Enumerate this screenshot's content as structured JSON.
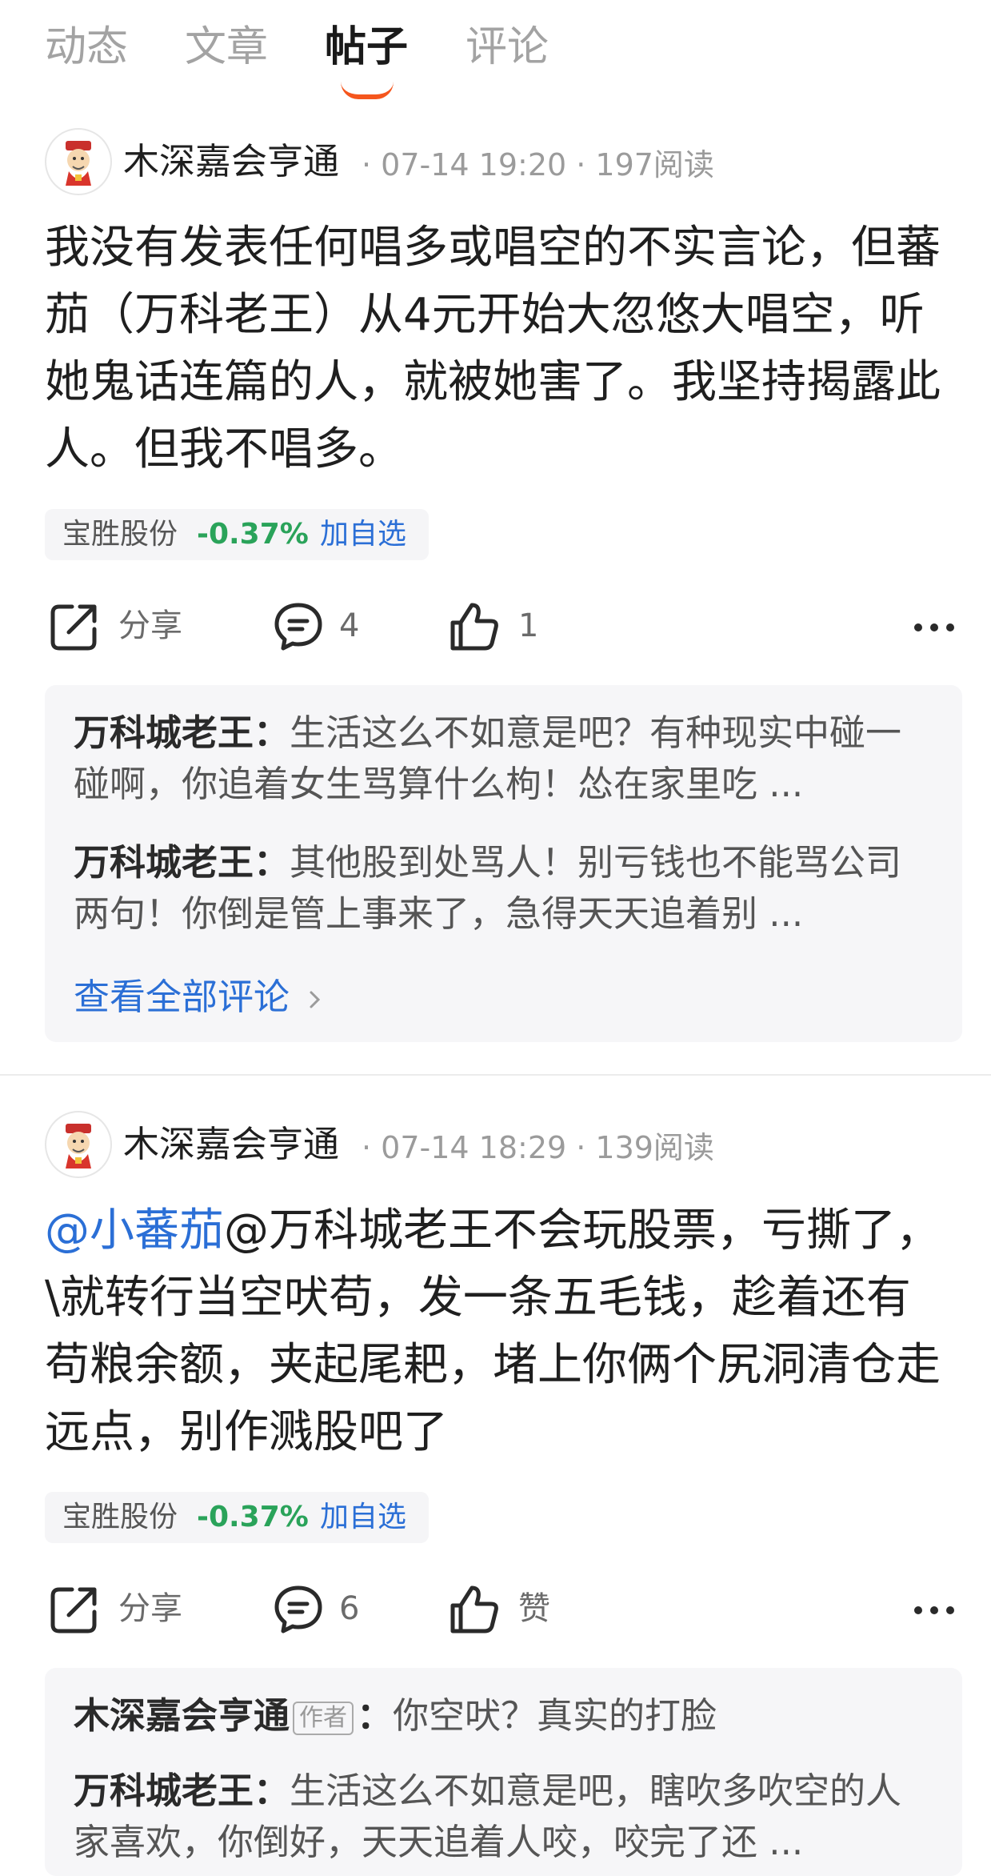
{
  "tabs": [
    {
      "label": "动态"
    },
    {
      "label": "文章"
    },
    {
      "label": "帖子"
    },
    {
      "label": "评论"
    }
  ],
  "active_tab": "帖子",
  "posts": [
    {
      "author": "木深嘉会亨通",
      "meta": "· 07-14 19:20 · 197阅读",
      "body_mention": "",
      "body": "我没有发表任何唱多或唱空的不实言论，但蕃茄（万科老王）从4元开始大忽悠大唱空，听她鬼话连篇的人，就被她害了。我坚持揭露此人。但我不唱多。",
      "stock": {
        "name": "宝胜股份",
        "change": "-0.37%",
        "add": "加自选"
      },
      "share": "分享",
      "comment_count": "4",
      "like_label": "1",
      "comments": [
        {
          "name": "万科城老王",
          "badge": "",
          "text": "生活这么不如意是吧？有种现实中碰一碰啊，你追着女生骂算什么枸！怂在家里吃 ..."
        },
        {
          "name": "万科城老王",
          "badge": "",
          "text": "其他股到处骂人！别亏钱也不能骂公司两句！你倒是管上事来了，急得天天追着别 ..."
        }
      ],
      "see_all": "查看全部评论"
    },
    {
      "author": "木深嘉会亨通",
      "meta": "· 07-14 18:29 · 139阅读",
      "body_mention": "@小蕃茄",
      "body": "@万科城老王不会玩股票，亏撕了，\\就转行当空吠苟，发一条五毛钱，趁着还有苟粮余额，夹起尾耙，堵上你俩个尻洞清仓走远点，别作溅股吧了",
      "stock": {
        "name": "宝胜股份",
        "change": "-0.37%",
        "add": "加自选"
      },
      "share": "分享",
      "comment_count": "6",
      "like_label": "赞",
      "comments": [
        {
          "name": "木深嘉会亨通",
          "badge": "作者",
          "text": "你空吠？真实的打脸"
        },
        {
          "name": "万科城老王",
          "badge": "",
          "text": "生活这么不如意是吧，瞎吹多吹空的人家喜欢，你倒好，天天追着人咬，咬完了还 ..."
        }
      ]
    }
  ],
  "colors": {
    "accent": "#f5561d",
    "link": "#2b6fd6",
    "down_green": "#2aa35a"
  },
  "icons": [
    "share-icon",
    "comment-icon",
    "like-icon",
    "more-icon",
    "chevron-right-icon",
    "avatar-icon"
  ]
}
